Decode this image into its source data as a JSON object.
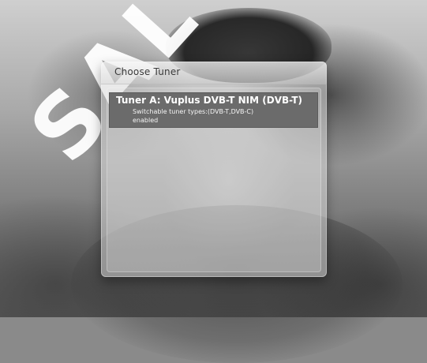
{
  "background": {
    "watermark_text": "SAL"
  },
  "dialog": {
    "title": "Choose Tuner",
    "items": [
      {
        "title": "Tuner A: Vuplus DVB-T NIM (DVB-T)",
        "detail": "Switchable tuner types:(DVB-T,DVB-C)",
        "status": "enabled",
        "selected": true
      }
    ]
  },
  "colors": {
    "selection": "#6b6b6b",
    "text_light": "#ffffff",
    "title_text": "#3a3a3a"
  }
}
